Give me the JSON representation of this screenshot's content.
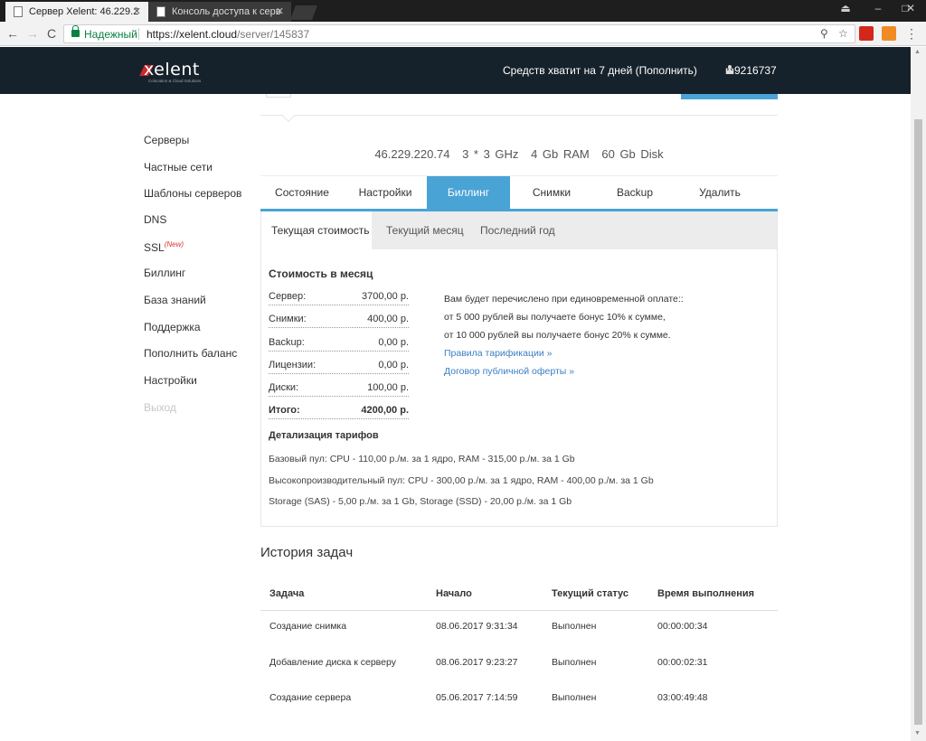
{
  "browser": {
    "tabs": [
      {
        "title": "Сервер Xelent: 46.229.2"
      },
      {
        "title": "Консоль доступа к серв"
      }
    ],
    "window_controls": [
      "–",
      "□",
      "✕"
    ],
    "profile_icon": "⏏",
    "nav": {
      "back": "←",
      "forward": "→",
      "reload": "C"
    },
    "secure_label": "Надежный",
    "url_base": "https://xelent.cloud",
    "url_path": "/server/145837",
    "zoom_icon": "⚲",
    "star_icon": "☆",
    "menu_icon": "⋮"
  },
  "header": {
    "logo": "xelent",
    "logo_sub": "Colocation & Cloud Solutions",
    "funds": "Средств хватит на 7 дней (Пополнить)",
    "user": "m9216737"
  },
  "sidebar": {
    "items": [
      {
        "label": "Серверы"
      },
      {
        "label": "Частные сети"
      },
      {
        "label": "Шаблоны серверов"
      },
      {
        "label": "DNS"
      },
      {
        "label": "SSL",
        "tag": "(New)"
      },
      {
        "label": "Биллинг"
      },
      {
        "label": "База знаний"
      },
      {
        "label": "Поддержка"
      },
      {
        "label": "Пополнить баланс"
      },
      {
        "label": "Настройки"
      },
      {
        "label": "Выход"
      }
    ]
  },
  "server": {
    "ip": "46.229.220.74",
    "cpu": "3 * 3 GHz",
    "ram": "4 Gb RAM",
    "disk": "60 Gb Disk"
  },
  "tabs": [
    "Состояние",
    "Настройки",
    "Биллинг",
    "Снимки",
    "Backup",
    "Удалить"
  ],
  "active_tab": "Биллинг",
  "subtabs": [
    "Текущая стоимость",
    "Текущий месяц",
    "Последний год"
  ],
  "billing": {
    "title": "Стоимость в месяц",
    "rows": [
      {
        "label": "Сервер:",
        "value": "3700,00 р."
      },
      {
        "label": "Снимки:",
        "value": "400,00 р."
      },
      {
        "label": "Backup:",
        "value": "0,00 р."
      },
      {
        "label": "Лицензии:",
        "value": "0,00 р."
      },
      {
        "label": "Диски:",
        "value": "100,00 р."
      }
    ],
    "total_label": "Итого:",
    "total_value": "4200,00 р.",
    "bonus_lines": [
      "Вам будет перечислено при единовременной оплате::",
      "от 5 000 рублей вы получаете бонус 10% к сумме,",
      "от 10 000 рублей вы получаете бонус 20% к сумме."
    ],
    "links": [
      "Правила тарификации »",
      "Договор публичной оферты »"
    ],
    "tariffs_title": "Детализация тарифов",
    "tariffs": [
      "Базовый пул: CPU - 110,00 р./м. за 1 ядро, RAM - 315,00 р./м. за 1 Gb",
      "Высокопроизводительный пул: CPU - 300,00 р./м. за 1 ядро, RAM - 400,00 р./м. за 1 Gb",
      "Storage (SAS) - 5,00 р./м. за 1 Gb, Storage (SSD) - 20,00 р./м. за 1 Gb"
    ]
  },
  "history": {
    "title": "История задач",
    "columns": [
      "Задача",
      "Начало",
      "Текущий статус",
      "Время выполнения"
    ],
    "rows": [
      [
        "Создание снимка",
        "08.06.2017 9:31:34",
        "Выполнен",
        "00:00:00:34"
      ],
      [
        "Добавление диска к серверу",
        "08.06.2017 9:23:27",
        "Выполнен",
        "00:00:02:31"
      ],
      [
        "Создание сервера",
        "05.06.2017 7:14:59",
        "Выполнен",
        "03:00:49:48"
      ]
    ]
  },
  "colors": {
    "accent": "#4aa3d5",
    "header_bg": "#16222b",
    "brand_red": "#c9282d",
    "secure_green": "#0b8043",
    "link": "#3b7fc4"
  }
}
